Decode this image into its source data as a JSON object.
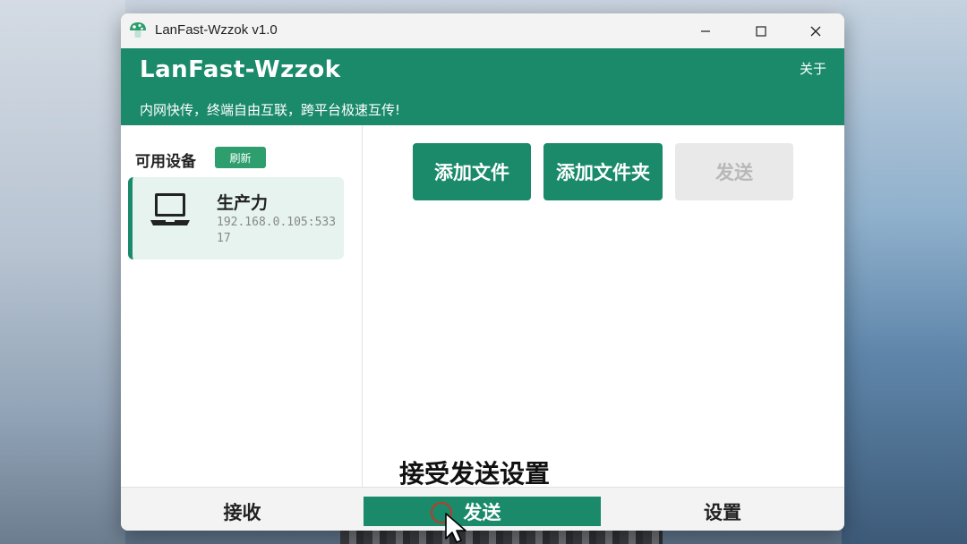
{
  "window": {
    "title": "LanFast-Wzzok v1.0",
    "app_icon": "mushroom-icon"
  },
  "header": {
    "app_name": "LanFast-Wzzok",
    "tagline": "内网快传，终端自由互联，跨平台极速互传!",
    "about_label": "关于"
  },
  "sidebar": {
    "title": "可用设备",
    "refresh_label": "刷新",
    "devices": [
      {
        "name": "生产力",
        "address": "192.168.0.105:53317",
        "icon": "laptop-icon"
      }
    ]
  },
  "main": {
    "add_file_label": "添加文件",
    "add_folder_label": "添加文件夹",
    "send_label": "发送",
    "send_enabled": false
  },
  "caption": "接受发送设置",
  "bottom_nav": {
    "tabs": [
      {
        "label": "接收",
        "active": false
      },
      {
        "label": "发送",
        "active": true
      },
      {
        "label": "设置",
        "active": false
      }
    ]
  },
  "colors": {
    "accent": "#1a8a6a",
    "refresh": "#2e9e6e",
    "device_card_bg": "#e6f3ee",
    "disabled_bg": "#e9e9e9"
  }
}
